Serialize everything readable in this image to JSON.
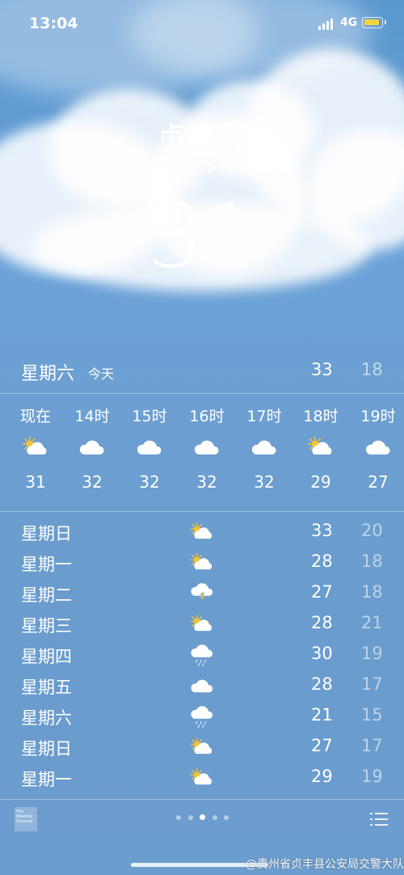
{
  "status": {
    "time": "13:04",
    "network": "4G"
  },
  "location": {
    "city": "贞丰县",
    "condition": "局部多云",
    "temperature": "31"
  },
  "today": {
    "day": "星期六",
    "tag": "今天",
    "high": "33",
    "low": "18"
  },
  "hourly": [
    {
      "label": "现在",
      "icon": "sun-cloud-icon",
      "temp": "31"
    },
    {
      "label": "14时",
      "icon": "cloud-icon",
      "temp": "32"
    },
    {
      "label": "15时",
      "icon": "cloud-icon",
      "temp": "32"
    },
    {
      "label": "16时",
      "icon": "cloud-icon",
      "temp": "32"
    },
    {
      "label": "17时",
      "icon": "cloud-icon",
      "temp": "32"
    },
    {
      "label": "18时",
      "icon": "sun-cloud-icon",
      "temp": "29"
    },
    {
      "label": "19时",
      "icon": "cloud-icon",
      "temp": "27"
    }
  ],
  "daily": [
    {
      "day": "星期日",
      "icon": "sun-cloud-icon",
      "high": "33",
      "low": "20"
    },
    {
      "day": "星期一",
      "icon": "sun-cloud-icon",
      "high": "28",
      "low": "18"
    },
    {
      "day": "星期二",
      "icon": "thunderstorm-icon",
      "high": "27",
      "low": "18"
    },
    {
      "day": "星期三",
      "icon": "sun-cloud-icon",
      "high": "28",
      "low": "21"
    },
    {
      "day": "星期四",
      "icon": "rain-icon",
      "high": "30",
      "low": "19"
    },
    {
      "day": "星期五",
      "icon": "cloud-icon",
      "high": "28",
      "low": "17"
    },
    {
      "day": "星期六",
      "icon": "rain-icon",
      "high": "21",
      "low": "15"
    },
    {
      "day": "星期日",
      "icon": "sun-cloud-icon",
      "high": "27",
      "low": "17"
    },
    {
      "day": "星期一",
      "icon": "sun-cloud-icon",
      "high": "29",
      "low": "19"
    }
  ],
  "footer": {
    "logo_text": "The Weather Channel",
    "page_dots": 5,
    "active_dot": 2
  },
  "watermark": "@贵州省贞丰县公安局交警大队",
  "colors": {
    "low_temp": "rgba(255,255,255,0.55)",
    "battery": "#f4d23a"
  }
}
